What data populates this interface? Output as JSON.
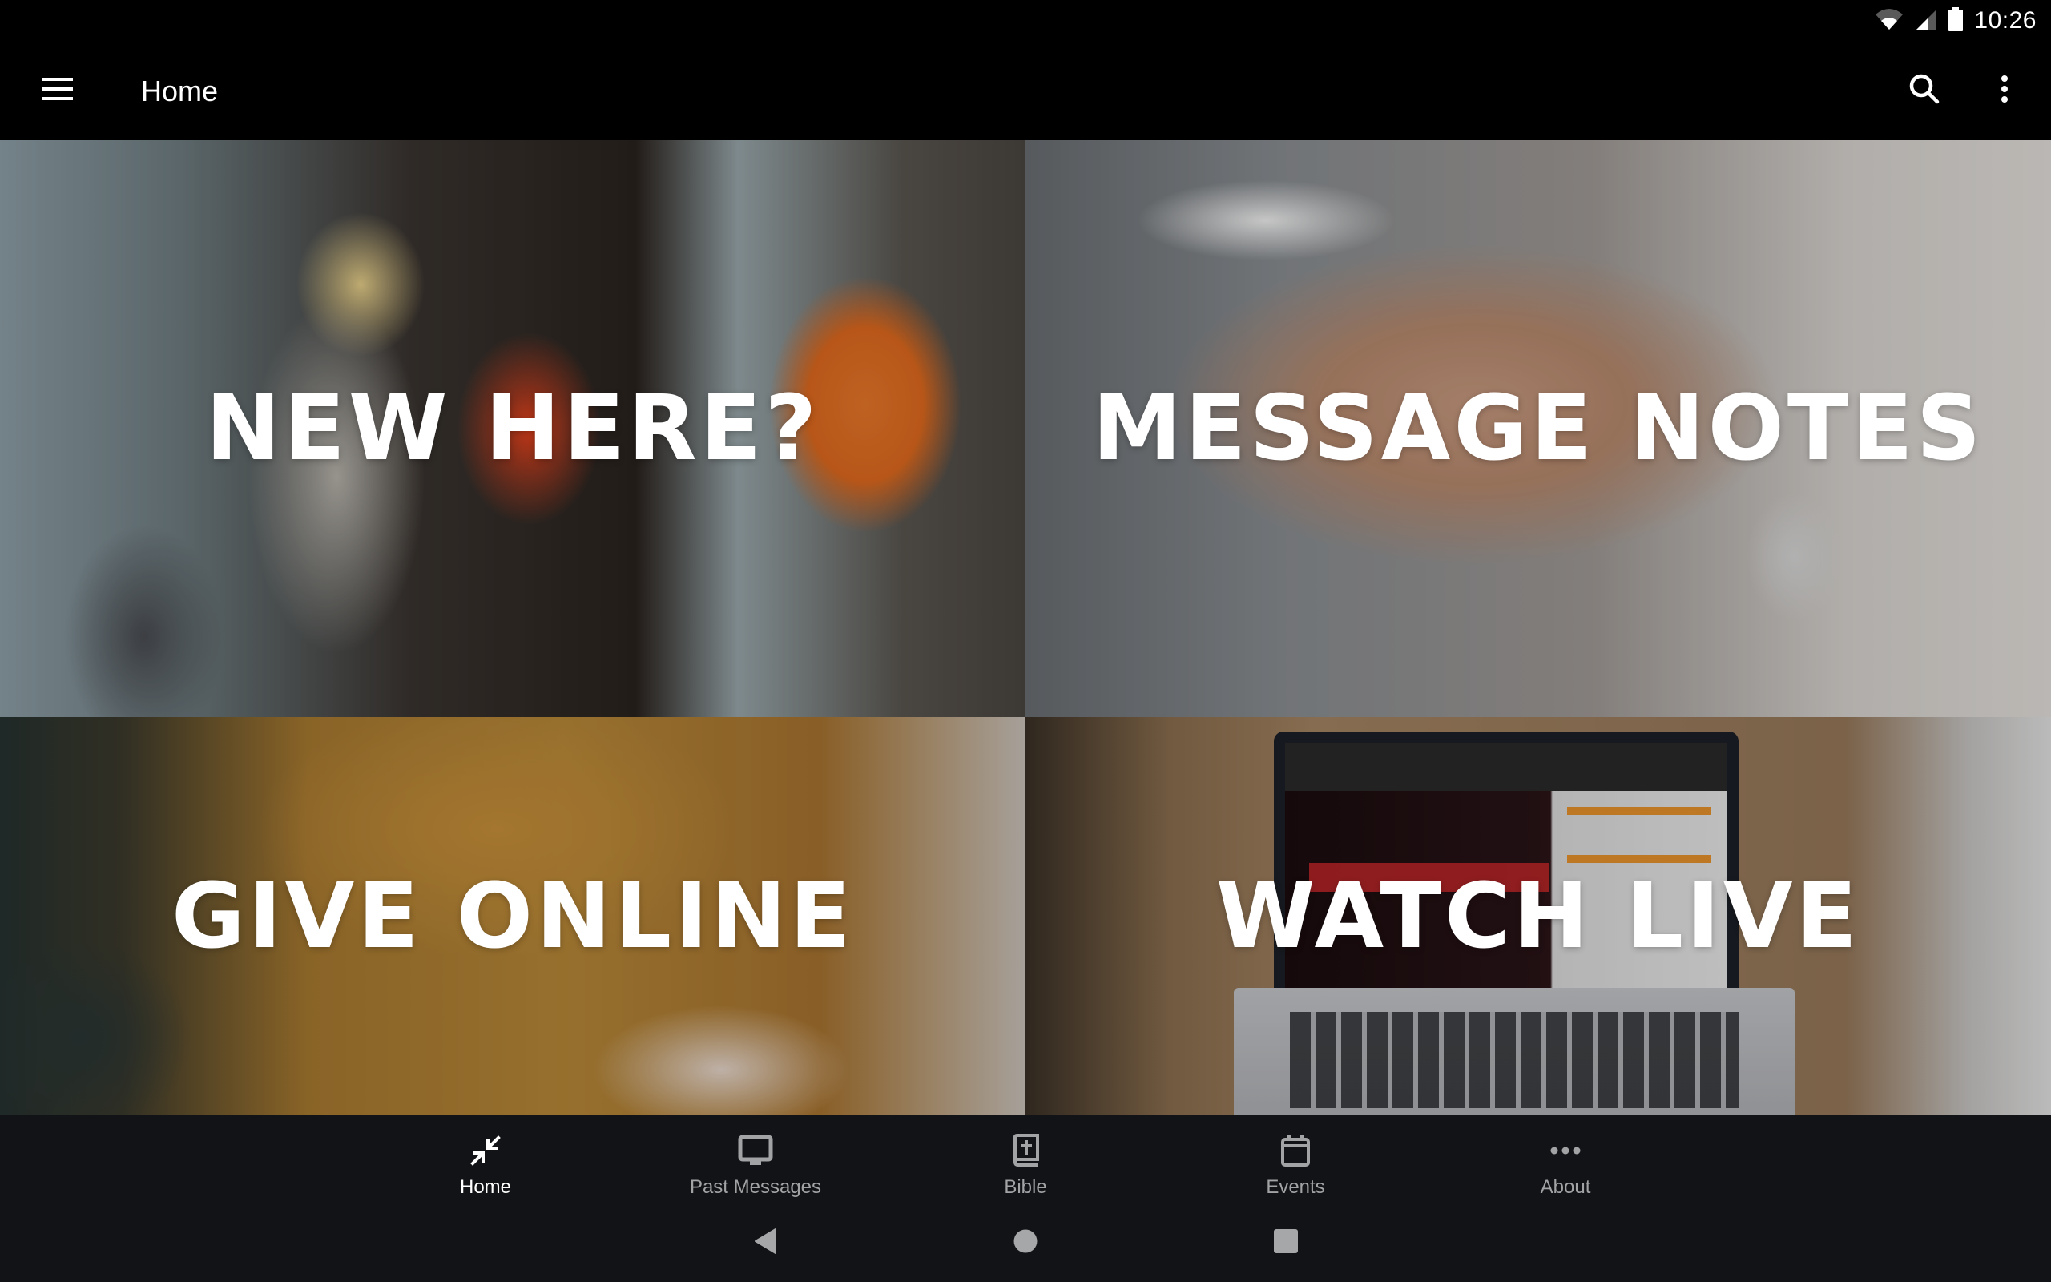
{
  "status_bar": {
    "time": "10:26",
    "icons": [
      "wifi-icon",
      "cellular-signal-icon",
      "battery-icon"
    ]
  },
  "toolbar": {
    "menu_icon": "hamburger-menu-icon",
    "title": "Home",
    "actions": [
      {
        "name": "search",
        "icon": "search-icon"
      },
      {
        "name": "more-options",
        "icon": "more-vert-icon"
      }
    ]
  },
  "tiles": [
    {
      "title": "NEW HERE?",
      "image": "people entering church entrance"
    },
    {
      "title": "MESSAGE NOTES",
      "image": "hand holding smartphone with watch"
    },
    {
      "title": "GIVE ONLINE",
      "image": "person in mustard sweater typing"
    },
    {
      "title": "WATCH LIVE",
      "image": "laptop streaming sermon on table"
    }
  ],
  "bottom_nav": {
    "active_index": 0,
    "items": [
      {
        "label": "Home",
        "icon": "collapse-arrows-icon"
      },
      {
        "label": "Past Messages",
        "icon": "monitor-icon"
      },
      {
        "label": "Bible",
        "icon": "bible-icon"
      },
      {
        "label": "Events",
        "icon": "calendar-icon"
      },
      {
        "label": "About",
        "icon": "more-horiz-icon"
      }
    ]
  },
  "system_nav": {
    "buttons": [
      "back",
      "home",
      "recents"
    ]
  },
  "colors": {
    "app_bar_bg": "#000000",
    "bottom_nav_bg": "#121316",
    "nav_inactive": "#a2a3a5",
    "nav_active": "#ffffff",
    "tile_text": "#ffffff"
  }
}
